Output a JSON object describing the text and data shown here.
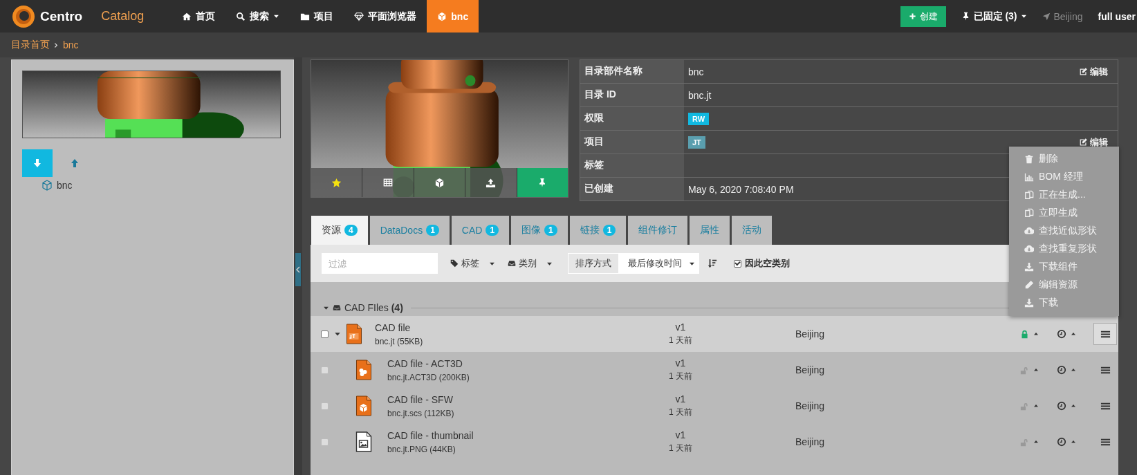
{
  "nav": {
    "logo": "Centro",
    "app": "Catalog",
    "items": [
      {
        "label": "首页",
        "selected": false,
        "dropdown": false
      },
      {
        "label": "搜索",
        "selected": false,
        "dropdown": true
      },
      {
        "label": "项目",
        "selected": false,
        "dropdown": false
      },
      {
        "label": "平面浏览器",
        "selected": false,
        "dropdown": false
      },
      {
        "label": "bnc",
        "selected": true,
        "dropdown": false
      }
    ],
    "create": "创建",
    "pinned": "已固定 (3)",
    "location": "Beijing",
    "user": "full user"
  },
  "breadcrumb": [
    "目录首页",
    "bnc"
  ],
  "left_panel": {
    "view_buttons": [
      {
        "selected": true
      },
      {
        "selected": false
      }
    ],
    "tree": [
      {
        "label": "bnc"
      }
    ]
  },
  "preview": {
    "favorite": true,
    "pinned": true
  },
  "details": [
    {
      "label": "目录部件名称",
      "kind": "text",
      "value": "bnc",
      "edit": "编辑"
    },
    {
      "label": "目录 ID",
      "kind": "text",
      "value": "bnc.jt"
    },
    {
      "label": "权限",
      "kind": "tag",
      "value": "RW",
      "color": "#11b8e0"
    },
    {
      "label": "项目",
      "kind": "tag",
      "value": "JT",
      "color": "#5a9eae",
      "edit": "编辑"
    },
    {
      "label": "标签"
    },
    {
      "label": "已创建",
      "kind": "text",
      "value": "May 6, 2020 7:08:40 PM"
    }
  ],
  "tabs": [
    {
      "label": "资源",
      "count": "4",
      "selected": true
    },
    {
      "label": "DataDocs",
      "count": "1",
      "selected": false
    },
    {
      "label": "CAD",
      "count": "1",
      "selected": false
    },
    {
      "label": "图像",
      "count": "1",
      "selected": false
    },
    {
      "label": "链接",
      "count": "1",
      "selected": false
    },
    {
      "label": "组件修订",
      "selected": false
    },
    {
      "label": "属性",
      "selected": false
    },
    {
      "label": "活动",
      "selected": false
    }
  ],
  "toolbar": {
    "filter_placeholder": "过滤",
    "tags": "标签",
    "category": "类别",
    "sort_label": "排序方式",
    "sort_value": "最后修改时间",
    "hide_empty": {
      "label": "因此空类别",
      "checked": true
    }
  },
  "group": {
    "title": "CAD FIles",
    "count": "(4)",
    "expanded": true
  },
  "files": [
    {
      "name": "CAD file",
      "detail": "bnc.jt (55KB)",
      "version": "v1",
      "age": "1 天前",
      "location": "Beijing",
      "kind": "jt",
      "locked": true,
      "selected": true,
      "checked": false,
      "expanded": true,
      "children": [
        {
          "name": "CAD file - ACT3D",
          "detail": "bnc.jt.ACT3D (200KB)",
          "version": "v1",
          "age": "1 天前",
          "location": "Beijing",
          "kind": "act3d",
          "locked": false,
          "selected": false,
          "checked": false
        },
        {
          "name": "CAD file - SFW",
          "detail": "bnc.jt.scs (112KB)",
          "version": "v1",
          "age": "1 天前",
          "location": "Beijing",
          "kind": "sfw",
          "locked": false,
          "selected": false,
          "checked": false
        },
        {
          "name": "CAD file - thumbnail",
          "detail": "bnc.jt.PNG (44KB)",
          "version": "v1",
          "age": "1 天前",
          "location": "Beijing",
          "locked": false,
          "selected": false,
          "checked": false
        }
      ]
    }
  ],
  "menu": [
    {
      "label": "删除"
    },
    {
      "label": "BOM 经理"
    },
    {
      "label": "正在生成..."
    },
    {
      "label": "立即生成"
    },
    {
      "label": "查找近似形状"
    },
    {
      "label": "查找重复形状"
    },
    {
      "label": "下载组件"
    },
    {
      "label": "编辑资源"
    },
    {
      "label": "下载"
    }
  ]
}
